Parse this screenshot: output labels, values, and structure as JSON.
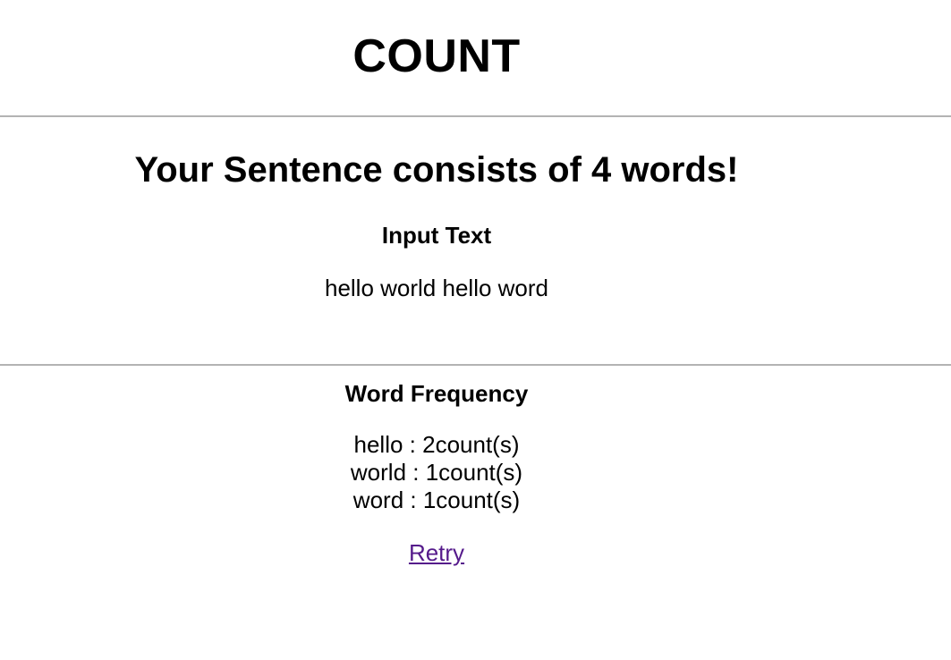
{
  "header": {
    "title": "COUNT"
  },
  "result": {
    "heading": "Your Sentence consists of 4 words!",
    "input_heading": "Input Text",
    "input_text": "hello world hello word"
  },
  "frequency": {
    "heading": "Word Frequency",
    "items": [
      "hello : 2count(s)",
      "world : 1count(s)",
      "word : 1count(s)"
    ]
  },
  "actions": {
    "retry_label": "Retry"
  },
  "colors": {
    "link_visited": "#551a8b",
    "rule": "#b3b3b3"
  }
}
